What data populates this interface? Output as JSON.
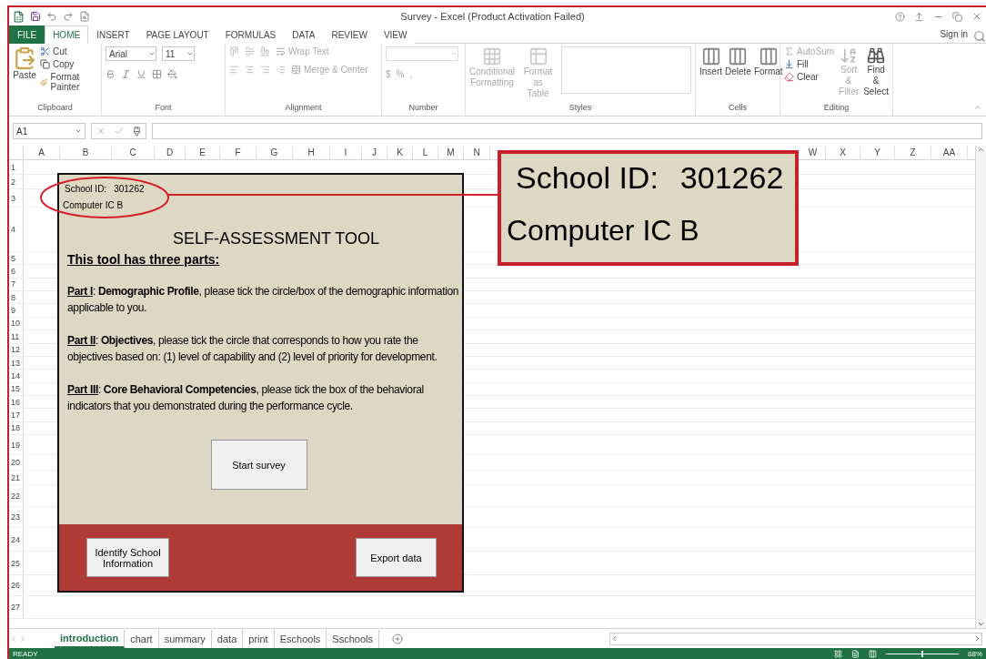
{
  "window": {
    "title": "Survey - Excel (Product Activation Failed)"
  },
  "ribbon_tabs": [
    {
      "label": "FILE",
      "kind": "file",
      "selected": false
    },
    {
      "label": "HOME",
      "kind": "tab",
      "selected": true
    },
    {
      "label": "INSERT",
      "kind": "tab",
      "selected": false
    },
    {
      "label": "PAGE LAYOUT",
      "kind": "tab",
      "selected": false
    },
    {
      "label": "FORMULAS",
      "kind": "tab",
      "selected": false
    },
    {
      "label": "DATA",
      "kind": "tab",
      "selected": false
    },
    {
      "label": "REVIEW",
      "kind": "tab",
      "selected": false
    },
    {
      "label": "VIEW",
      "kind": "tab",
      "selected": false
    }
  ],
  "sign_in": "Sign in",
  "ribbon": {
    "clipboard": {
      "label": "Clipboard",
      "paste": "Paste",
      "cut": "Cut",
      "copy": "Copy",
      "format_painter": "Format Painter"
    },
    "font": {
      "label": "Font",
      "name": "Arial",
      "size": "11"
    },
    "alignment": {
      "label": "Alignment",
      "disabled": true,
      "wrap_text": "Wrap Text",
      "merge_center": "Merge & Center"
    },
    "number": {
      "label": "Number",
      "disabled": true,
      "symbols": [
        "$",
        "%",
        ","
      ]
    },
    "styles": {
      "label": "Styles",
      "disabled": true,
      "conditional": "Conditional\nFormatting",
      "format_table": "Format as\nTable"
    },
    "cells": {
      "label": "Cells",
      "buttons": [
        "Insert",
        "Delete",
        "Format"
      ]
    },
    "editing": {
      "label": "Editing",
      "autosum": {
        "label": "AutoSum",
        "disabled": true
      },
      "fill": {
        "label": "Fill",
        "disabled": false
      },
      "clear": {
        "label": "Clear",
        "disabled": false
      },
      "sort_filter": {
        "label": "Sort &\nFilter",
        "disabled": true
      },
      "find_select": {
        "label": "Find &\nSelect",
        "disabled": false
      }
    }
  },
  "formula_bar": {
    "name_box": "A1"
  },
  "columns": [
    "A",
    "B",
    "C",
    "D",
    "E",
    "F",
    "G",
    "H",
    "I",
    "J",
    "K",
    "L",
    "M",
    "N",
    "W",
    "X",
    "Y",
    "Z",
    "AA"
  ],
  "rows": [
    "1",
    "2",
    "3",
    "4",
    "5",
    "6",
    "7",
    "8",
    "9",
    "10",
    "11",
    "12",
    "13",
    "14",
    "15",
    "16",
    "17",
    "18",
    "19",
    "20",
    "21",
    "22",
    "23",
    "24",
    "25",
    "26",
    "27"
  ],
  "form": {
    "school_id_label": "School ID:",
    "school_id": "301262",
    "computer_id": "Computer IC B",
    "title": "SELF-ASSESSMENT TOOL",
    "heading": "This tool has three parts:",
    "parts": [
      {
        "label": "Part I",
        "text": ": **Demographic Profile**, please tick the circle/box of the demographic information applicable to you."
      },
      {
        "label": "Part II",
        "text": ": **Objectives**, please tick the circle that corresponds to how you rate the objectives based on: (1) level of capability and (2) level of priority for development."
      },
      {
        "label": "Part III",
        "text": ": **Core Behavioral Competencies**, please tick the box of the behavioral indicators that you demonstrated during the performance cycle."
      }
    ],
    "start_button": "Start survey",
    "identify_button": "Identify School\nInformation",
    "export_button": "Export data"
  },
  "callout": {
    "school_id_label": "School ID:",
    "school_id": "301262",
    "computer_id": "Computer IC B"
  },
  "sheet_tabs": [
    {
      "label": "introduction",
      "selected": true
    },
    {
      "label": "chart",
      "selected": false
    },
    {
      "label": "summary",
      "selected": false
    },
    {
      "label": "data",
      "selected": false
    },
    {
      "label": "print",
      "selected": false
    },
    {
      "label": "Eschools",
      "selected": false
    },
    {
      "label": "Sschools",
      "selected": false
    }
  ],
  "status_bar": {
    "status": "READY",
    "zoom_slider": {
      "level": 0.5
    },
    "zoom": "88%"
  }
}
